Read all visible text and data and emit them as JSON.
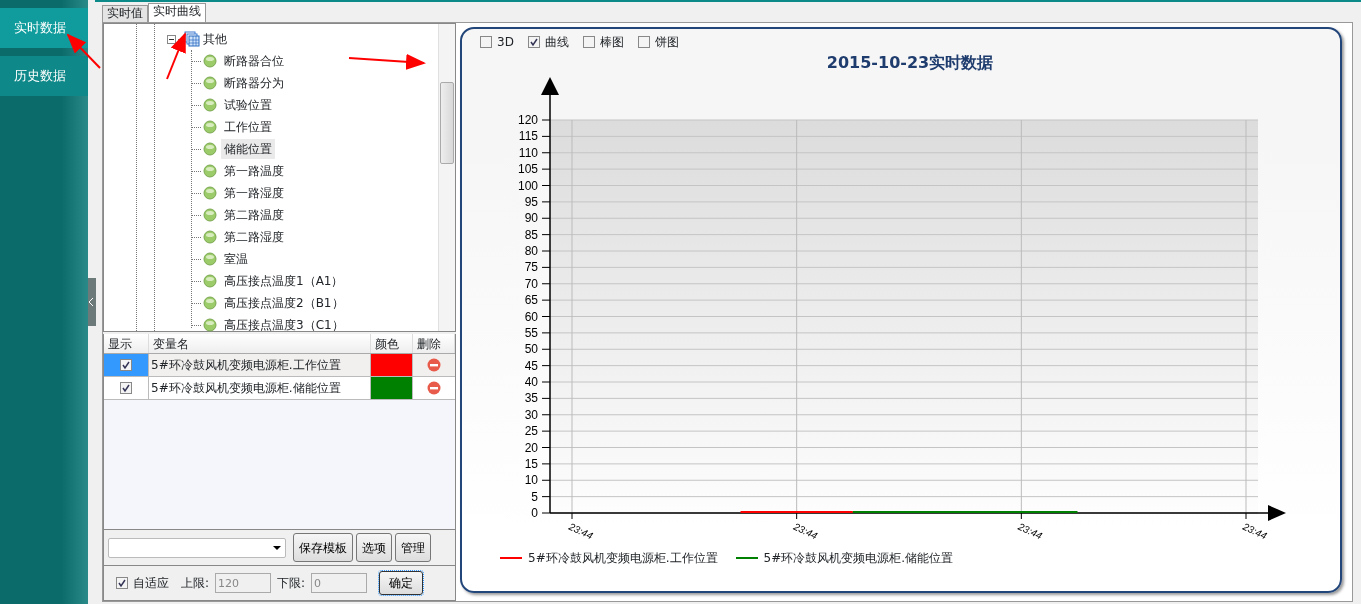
{
  "sidebar": {
    "items": [
      {
        "label": "实时数据",
        "selected": true
      },
      {
        "label": "历史数据",
        "selected": false
      }
    ]
  },
  "tabs": [
    {
      "label": "实时值",
      "selected": false
    },
    {
      "label": "实时曲线",
      "selected": true
    }
  ],
  "tree": {
    "items": [
      {
        "label": "其他",
        "expanded": true,
        "children": [
          {
            "label": "断路器合位",
            "selected": false
          },
          {
            "label": "断路器分为",
            "selected": false
          },
          {
            "label": "试验位置",
            "selected": false
          },
          {
            "label": "工作位置",
            "selected": false
          },
          {
            "label": "储能位置",
            "selected": true
          },
          {
            "label": "第一路温度",
            "selected": false
          },
          {
            "label": "第一路湿度",
            "selected": false
          },
          {
            "label": "第二路温度",
            "selected": false
          },
          {
            "label": "第二路湿度",
            "selected": false
          },
          {
            "label": "室温",
            "selected": false
          },
          {
            "label": "高压接点温度1（A1）",
            "selected": false
          },
          {
            "label": "高压接点温度2（B1）",
            "selected": false
          },
          {
            "label": "高压接点温度3（C1）",
            "selected": false
          }
        ]
      }
    ]
  },
  "table": {
    "columns": [
      "显示",
      "变量名",
      "颜色",
      "删除"
    ],
    "rows": [
      {
        "checked": true,
        "selected": true,
        "name": "5#环冷鼓风机变频电源柜.工作位置",
        "color": "#ff0000"
      },
      {
        "checked": true,
        "selected": false,
        "name": "5#环冷鼓风机变频电源柜.储能位置",
        "color": "#008000"
      }
    ]
  },
  "template_buttons": [
    "保存模板",
    "选项",
    "管理"
  ],
  "limits": {
    "auto_label": "自适应",
    "auto_checked": true,
    "upper_label": "上限:",
    "upper_value": "120",
    "lower_label": "下限:",
    "lower_value": "0",
    "confirm": "确定"
  },
  "chart_options": [
    {
      "label": "3D",
      "checked": false
    },
    {
      "label": "曲线",
      "checked": true
    },
    {
      "label": "棒图",
      "checked": false
    },
    {
      "label": "饼图",
      "checked": false
    }
  ],
  "chart": {
    "chart_data": {
      "type": "line",
      "grid": true,
      "title": "2015-10-23实时数据",
      "categories": [
        "23:44",
        null,
        null,
        null,
        "23:44",
        null,
        null,
        null,
        "23:44",
        null,
        null,
        null,
        "23:44"
      ],
      "ylim": [
        0,
        120
      ],
      "yticks": [
        0,
        5,
        10,
        15,
        20,
        25,
        30,
        35,
        40,
        45,
        50,
        55,
        60,
        65,
        70,
        75,
        80,
        85,
        90,
        95,
        100,
        105,
        110,
        115,
        120
      ],
      "series": [
        {
          "name": "5#环冷鼓风机变频电源柜.工作位置",
          "color": "#ff0000",
          "values": [
            null,
            null,
            null,
            0,
            0,
            0,
            null,
            null,
            null,
            null,
            null,
            null,
            null
          ]
        },
        {
          "name": "5#环冷鼓风机变频电源柜.储能位置",
          "color": "#008000",
          "values": [
            null,
            null,
            null,
            null,
            null,
            0,
            0,
            0,
            0,
            0,
            null,
            null,
            null
          ]
        }
      ]
    }
  }
}
